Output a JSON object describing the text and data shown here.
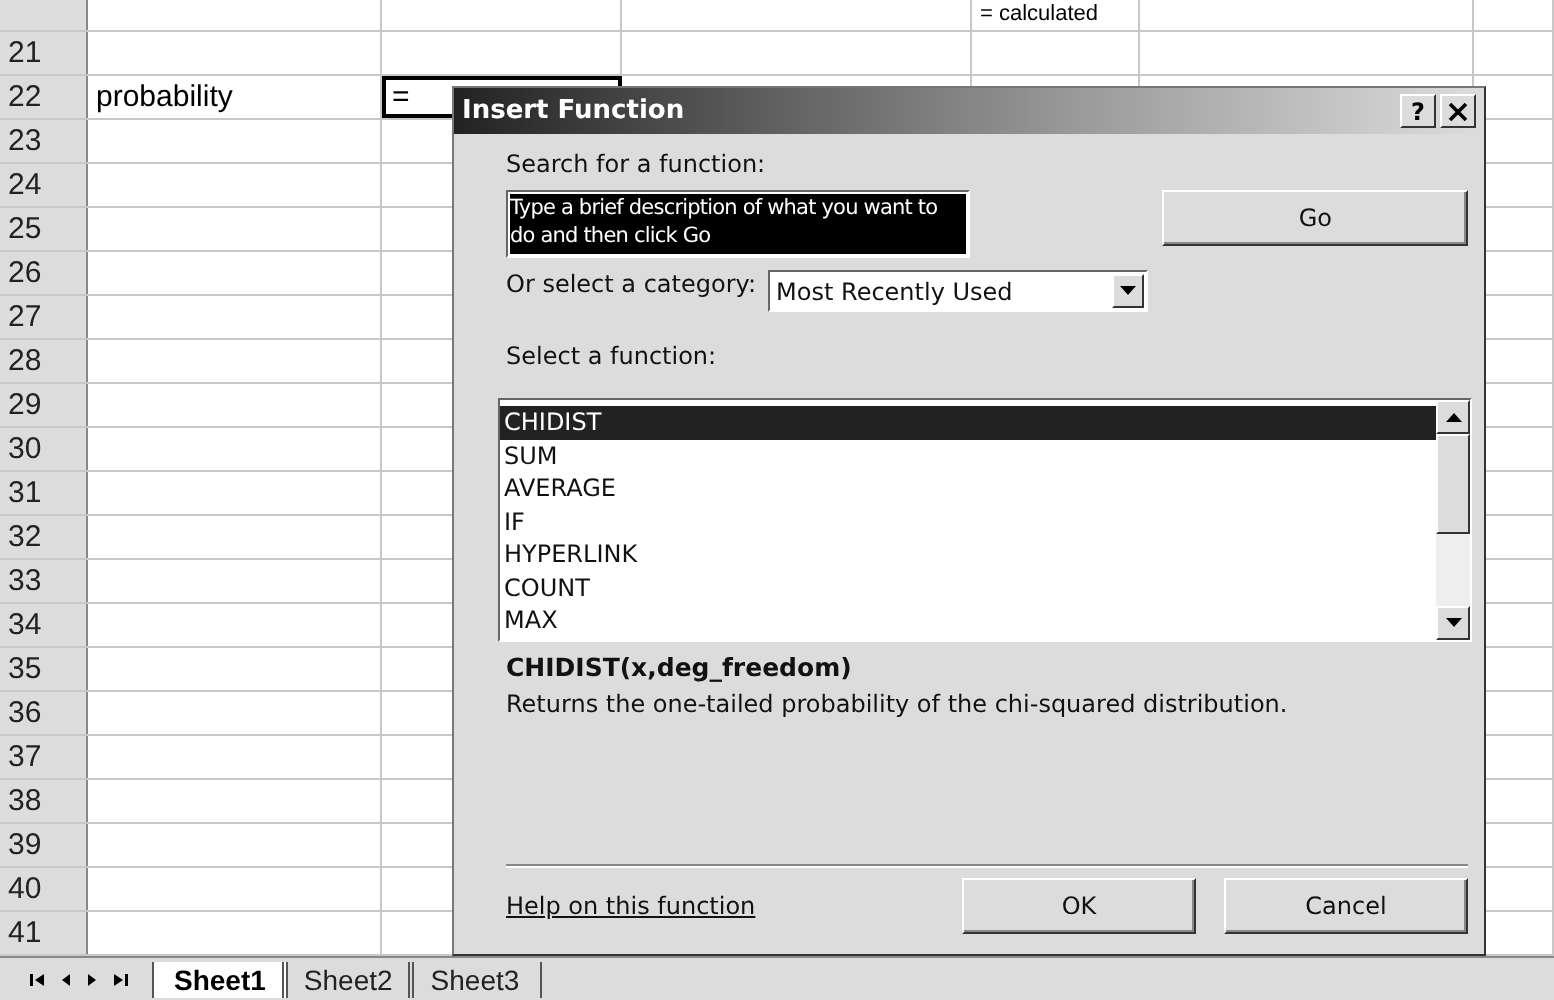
{
  "sheet": {
    "partial_row": {
      "column_d": "= calculated"
    },
    "rows": [
      {
        "header": "21"
      },
      {
        "header": "22",
        "label": "probability",
        "active_entry": "="
      },
      {
        "header": "23"
      },
      {
        "header": "24"
      },
      {
        "header": "25"
      },
      {
        "header": "26"
      },
      {
        "header": "27"
      },
      {
        "header": "28"
      },
      {
        "header": "29"
      },
      {
        "header": "30"
      },
      {
        "header": "31"
      },
      {
        "header": "32"
      },
      {
        "header": "33"
      },
      {
        "header": "34"
      },
      {
        "header": "35"
      },
      {
        "header": "36"
      },
      {
        "header": "37"
      },
      {
        "header": "38"
      },
      {
        "header": "39"
      },
      {
        "header": "40"
      },
      {
        "header": "41"
      }
    ],
    "tabs": [
      {
        "label": "Sheet1",
        "selected": true
      },
      {
        "label": "Sheet2",
        "selected": false
      },
      {
        "label": "Sheet3",
        "selected": false
      }
    ]
  },
  "dialog": {
    "title": "Insert Function",
    "help_button": "?",
    "search_label": "Search for a function:",
    "search_value": "Type a brief description of what you want to do and then click Go",
    "go_button": "Go",
    "category_label": "Or select a category:",
    "category_value": "Most Recently Used",
    "function_label": "Select a function:",
    "functions": [
      {
        "name": "CHIDIST",
        "selected": true
      },
      {
        "name": "SUM",
        "selected": false
      },
      {
        "name": "AVERAGE",
        "selected": false
      },
      {
        "name": "IF",
        "selected": false
      },
      {
        "name": "HYPERLINK",
        "selected": false
      },
      {
        "name": "COUNT",
        "selected": false
      },
      {
        "name": "MAX",
        "selected": false
      }
    ],
    "signature": "CHIDIST(x,deg_freedom)",
    "description": "Returns the one-tailed probability of the chi-squared distribution.",
    "help_link": "Help on this function",
    "ok_button": "OK",
    "cancel_button": "Cancel"
  }
}
